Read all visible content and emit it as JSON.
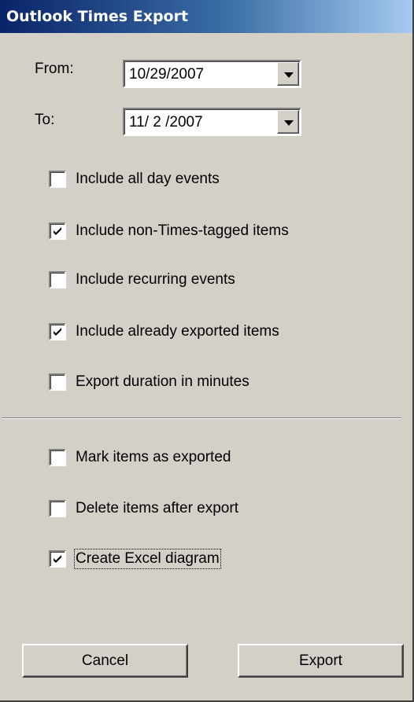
{
  "window": {
    "title": "Outlook Times Export"
  },
  "from": {
    "label": "From:",
    "value": "10/29/2007"
  },
  "to": {
    "label": "To:",
    "value": "11/ 2 /2007"
  },
  "options": [
    {
      "label": "Include all day events",
      "checked": false
    },
    {
      "label": "Include non-Times-tagged items",
      "checked": true
    },
    {
      "label": "Include recurring events",
      "checked": false
    },
    {
      "label": "Include already exported items",
      "checked": true
    },
    {
      "label": "Export duration in minutes",
      "checked": false
    }
  ],
  "post_options": [
    {
      "label": "Mark items as exported",
      "checked": false
    },
    {
      "label": "Delete items after export",
      "checked": false
    },
    {
      "label": "Create Excel diagram",
      "checked": true,
      "focused": true
    }
  ],
  "buttons": {
    "cancel": "Cancel",
    "export": "Export"
  }
}
